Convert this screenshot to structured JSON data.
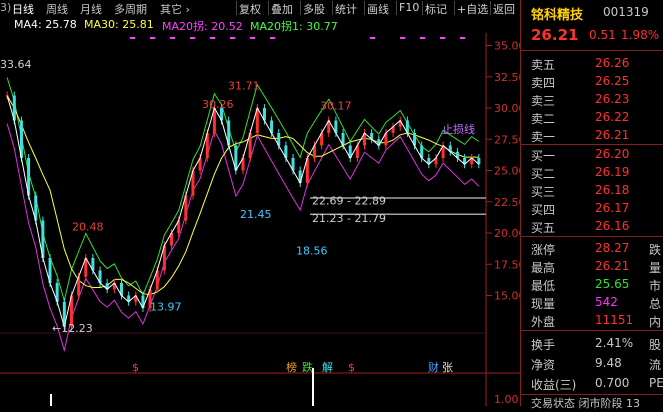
{
  "tabs": {
    "prefix": "3)",
    "items": [
      "日线",
      "周线",
      "月线",
      "多周期",
      "其它 ›"
    ]
  },
  "toolbar": {
    "items": [
      "复权",
      "叠加",
      "多股",
      "统计",
      "画线",
      "F10",
      "标记",
      "+自选",
      "返回"
    ]
  },
  "indicators": {
    "ma4": "MA4: 25.78",
    "ma30": "MA30: 25.81",
    "ma20lo": "MA20拐: 20.52",
    "ma20hi": "MA20拐1: 30.77"
  },
  "chart_data": {
    "type": "line",
    "ylim": [
      12,
      36
    ],
    "yticks": [
      "35.00",
      "32.50",
      "30.00",
      "27.50",
      "25.00",
      "22.50",
      "20.00",
      "17.50",
      "15.00"
    ],
    "volume_tick": "1.00",
    "price_labels": [
      {
        "text": "33.64",
        "color": "#d0d0d0"
      },
      {
        "text": "20.48",
        "color": "#e84040"
      },
      {
        "text": "←12.23",
        "color": "#d0d0d0"
      },
      {
        "text": "13.97",
        "color": "#40c8ff"
      },
      {
        "text": "21.45",
        "color": "#40c8ff"
      },
      {
        "text": "30.26",
        "color": "#e84040"
      },
      {
        "text": "31.71",
        "color": "#e84040"
      },
      {
        "text": "30.17",
        "color": "#e84040"
      },
      {
        "text": "18.56",
        "color": "#40c8ff"
      },
      {
        "text": "22.69 - 22.89",
        "color": "#d0d0d0"
      },
      {
        "text": "21.23 - 21.79",
        "color": "#d0d0d0"
      },
      {
        "text": "止损线",
        "color": "#c070ff"
      }
    ],
    "markers": [
      {
        "text": "$",
        "color": "#e84040"
      },
      {
        "text": "榜",
        "color": "#e8a020"
      },
      {
        "text": "跌",
        "color": "#40e040"
      },
      {
        "text": "解",
        "color": "#40e0e0"
      },
      {
        "text": "$",
        "color": "#e84040"
      },
      {
        "text": "财",
        "color": "#40a0ff"
      },
      {
        "text": "张",
        "color": "#e0e0e0"
      }
    ],
    "close": [
      31,
      29,
      26,
      23,
      21,
      18,
      16,
      14.5,
      12.5,
      15,
      16.5,
      18,
      17,
      16,
      15.5,
      16,
      15,
      14.5,
      15,
      14,
      15.5,
      17,
      19,
      20,
      21,
      23,
      25,
      26,
      28,
      30,
      29,
      27,
      25,
      26,
      28,
      30,
      29,
      28,
      27,
      26,
      25,
      24,
      26,
      27,
      28,
      29,
      28,
      27,
      26,
      27,
      28,
      27.5,
      27,
      28,
      28.5,
      29,
      28,
      27,
      26,
      25.5,
      26,
      27,
      26.5,
      26,
      25.5,
      26,
      25.5
    ]
  },
  "quote": {
    "name": "铭科精技",
    "code": "001319",
    "price": "26.21",
    "change": "0.51",
    "pct": "1.98%",
    "sell": [
      {
        "l": "卖五",
        "p": "26.26"
      },
      {
        "l": "卖四",
        "p": "26.25"
      },
      {
        "l": "卖三",
        "p": "26.23"
      },
      {
        "l": "卖二",
        "p": "26.22"
      },
      {
        "l": "卖一",
        "p": "26.21"
      }
    ],
    "buy": [
      {
        "l": "买一",
        "p": "26.20"
      },
      {
        "l": "买二",
        "p": "26.19"
      },
      {
        "l": "买三",
        "p": "26.18"
      },
      {
        "l": "买四",
        "p": "26.17"
      },
      {
        "l": "买五",
        "p": "26.16"
      }
    ],
    "stats": [
      {
        "l": "涨停",
        "v": "28.27",
        "s": "跌"
      },
      {
        "l": "最高",
        "v": "26.21",
        "s": "量"
      },
      {
        "l": "最低",
        "v": "25.65",
        "s": "市"
      },
      {
        "l": "现量",
        "v": "542",
        "s": "总"
      },
      {
        "l": "外盘",
        "v": "11151",
        "s": "内"
      }
    ],
    "stats2": [
      {
        "l": "换手",
        "v": "2.41%",
        "s": "股"
      },
      {
        "l": "净资",
        "v": "9.48",
        "s": "流"
      },
      {
        "l": "收益(三)",
        "v": "0.700",
        "s": "PE"
      }
    ],
    "footer": "交易状态  闭市阶段 13"
  }
}
